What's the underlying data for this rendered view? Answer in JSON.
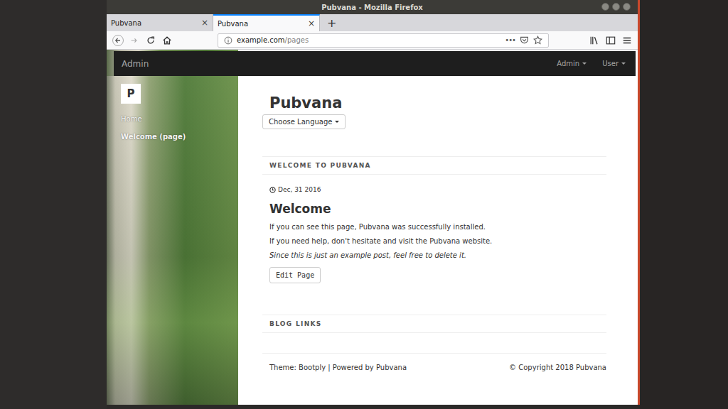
{
  "window": {
    "title": "Pubvana - Mozilla Firefox"
  },
  "tabs": [
    {
      "label": "Pubvana",
      "close": "×",
      "selected": false
    },
    {
      "label": "Pubvana",
      "close": "×",
      "selected": true
    }
  ],
  "new_tab": "+",
  "url": {
    "host": "example.com",
    "path": "/pages"
  },
  "page_actions": "•••",
  "site": {
    "navbar": {
      "brand": "Admin",
      "menus": [
        {
          "label": "Admin"
        },
        {
          "label": "User"
        }
      ]
    },
    "sidebar": {
      "logo": "P",
      "items": [
        {
          "label": "Home",
          "selected": false
        },
        {
          "label": "Welcome (page)",
          "selected": true
        }
      ]
    },
    "title": "Pubvana",
    "language_button": "Choose Language",
    "section_title": "WELCOME TO PUBVANA",
    "post": {
      "date": "Dec, 31 2016",
      "title": "Welcome",
      "paragraphs": [
        {
          "text": "If you can see this page, Pubvana was successfully installed.",
          "italic": false
        },
        {
          "text": "If you need help, don't hesitate and visit the Pubvana website.",
          "italic": false
        },
        {
          "text": "Since this is just an example post, feel free to delete it.",
          "italic": true
        }
      ],
      "edit_button": "Edit Page"
    },
    "links_title": "BLOG LINKS",
    "footer": {
      "left": "Theme: Bootply | Powered by Pubvana",
      "right": "© Copyright 2018 Pubvana"
    }
  }
}
